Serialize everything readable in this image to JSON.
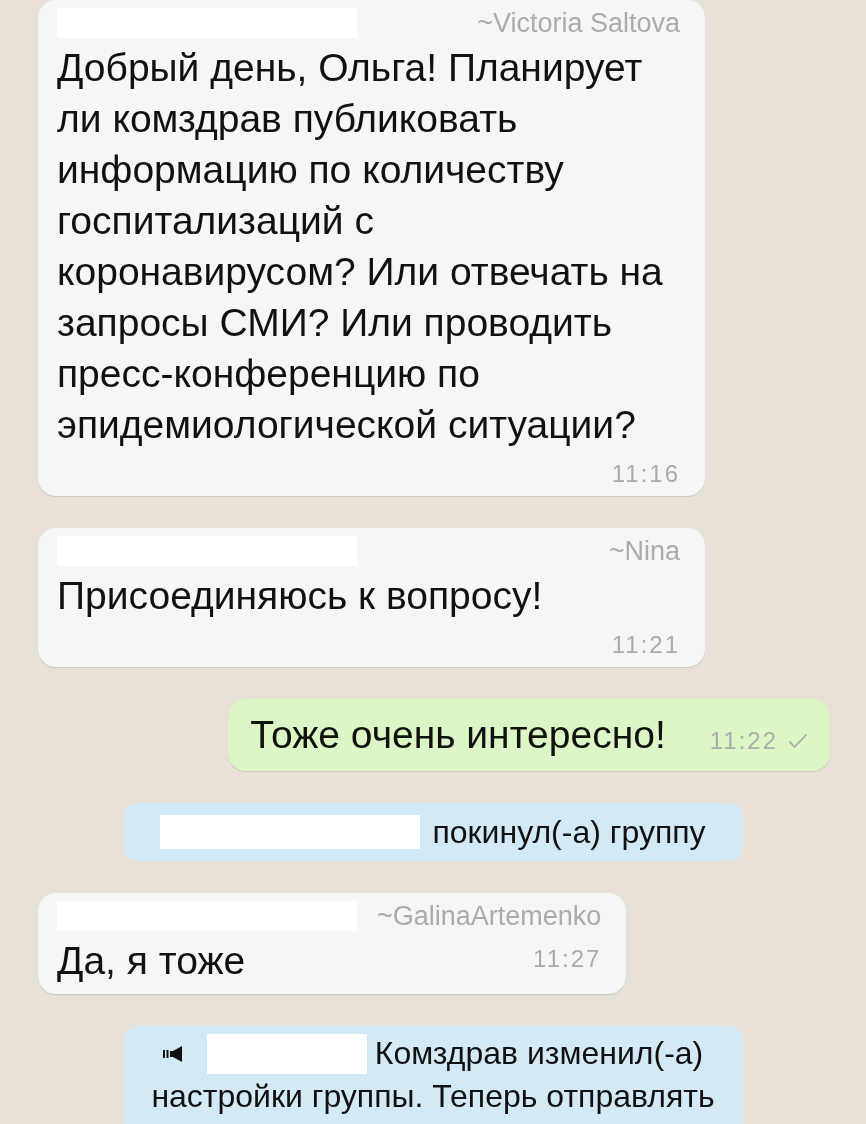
{
  "messages": [
    {
      "kind": "incoming",
      "redacted": true,
      "sender": "~Victoria Saltova",
      "text": "Добрый день, Ольга! Планирует ли комздрав публиковать информацию по количеству госпитализаций с коронавирусом? Или отвечать на запросы СМИ? Или проводить пресс-конференцию по эпидемиологической ситуации?",
      "time": "11:16"
    },
    {
      "kind": "incoming",
      "redacted": true,
      "sender": "~Nina",
      "text": "Присоединяюсь к вопросу!",
      "time": "11:21"
    },
    {
      "kind": "outgoing",
      "text": "Тоже очень интересно!",
      "time": "11:22",
      "delivered": false
    },
    {
      "kind": "notice",
      "redacted": true,
      "text": "покинул(-а) группу"
    },
    {
      "kind": "incoming",
      "redacted": true,
      "sender": "~GalinaArtemenko",
      "text": "Да, я тоже",
      "time": "11:27"
    },
    {
      "kind": "announcement",
      "redacted": true,
      "lines": [
        "Комздрав изменил(-а)",
        "настройки группы. Теперь отправлять"
      ]
    }
  ]
}
